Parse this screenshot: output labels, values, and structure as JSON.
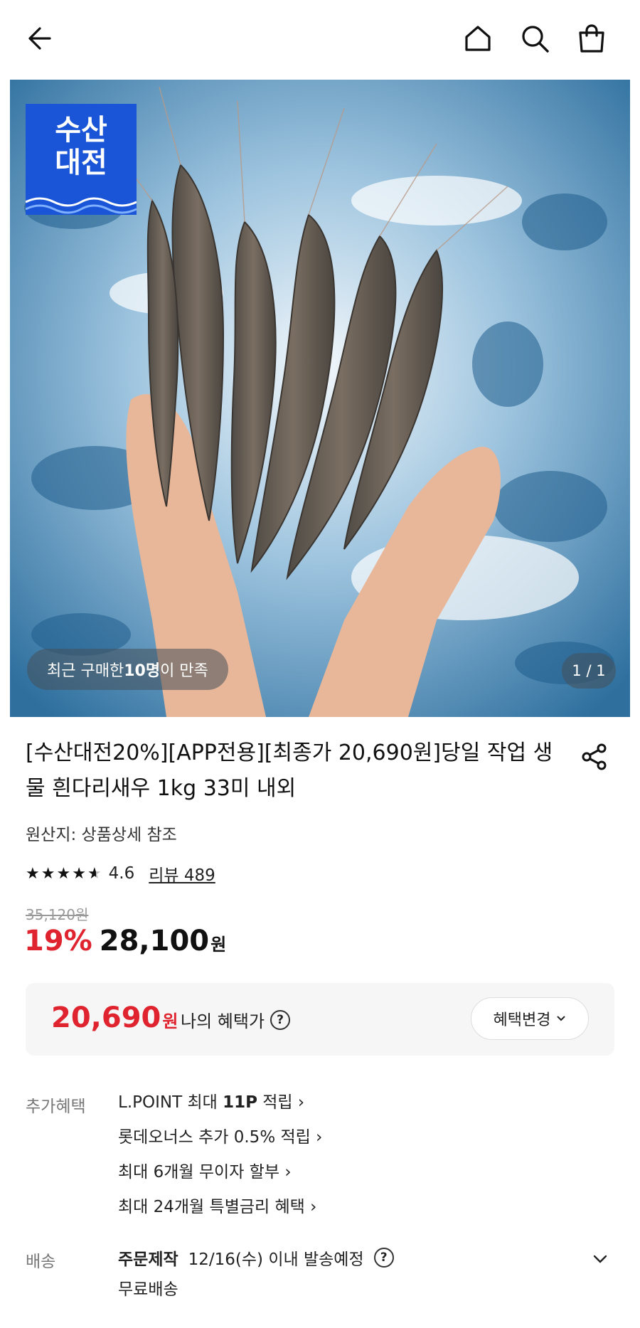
{
  "header": {
    "icons": [
      "back-arrow-icon",
      "home-icon",
      "search-icon",
      "shopping-bag-icon"
    ]
  },
  "hero": {
    "badge": {
      "line1": "수산",
      "line2": "대전"
    },
    "satisfaction": {
      "prefix": "최근 구매한 ",
      "count": "10명",
      "suffix": "이 만족"
    },
    "pager": "1 / 1"
  },
  "product": {
    "title": "[수산대전20%][APP전용][최종가 20,690원]당일 작업 생물 흰다리새우 1kg 33미 내외",
    "origin": "원산지: 상품상세 참조",
    "rating": {
      "score": "4.6",
      "stars": 4.6,
      "review_text": "리뷰 489"
    },
    "original_price": "35,120원",
    "discount": "19%",
    "price": "28,100",
    "price_unit": "원"
  },
  "benefit": {
    "price": "20,690",
    "unit": "원",
    "label": "나의 혜택가",
    "help": "?",
    "change_button": "혜택변경"
  },
  "extra": {
    "label": "추가혜택",
    "items": [
      {
        "pre": "L.POINT 최대 ",
        "bold": "11P",
        "post": " 적립 ›"
      },
      {
        "pre": "롯데오너스 추가 0.5% 적립 ›",
        "bold": "",
        "post": ""
      },
      {
        "pre": "최대 6개월 무이자 할부 ›",
        "bold": "",
        "post": ""
      },
      {
        "pre": "최대 24개월 특별금리 혜택 ›",
        "bold": "",
        "post": ""
      }
    ]
  },
  "delivery": {
    "label": "배송",
    "type": "주문제작",
    "schedule": "12/16(수) 이내 발송예정",
    "help": "?",
    "fee": "무료배송"
  },
  "colors": {
    "accent_red": "#e0242f",
    "badge_blue": "#1a55d8"
  }
}
